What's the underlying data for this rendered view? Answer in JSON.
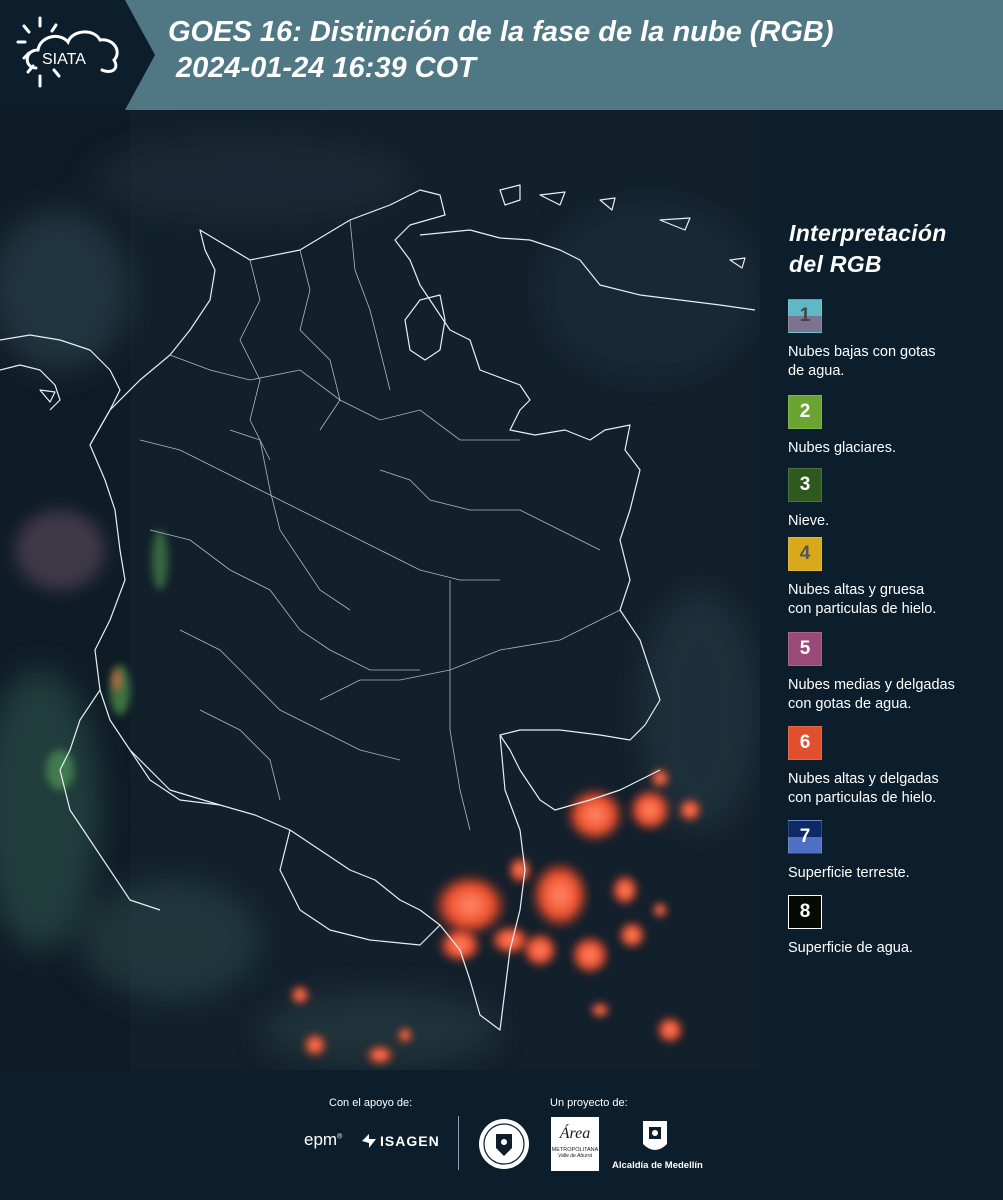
{
  "header": {
    "logo_text": "SIATA",
    "title_line1": "GOES 16: Distinción de la fase de la nube (RGB)",
    "title_line2": "2024-01-24 16:39 COT",
    "band_color": "#4f7784"
  },
  "legend": {
    "title_line1": "Interpretación",
    "title_line2": "del RGB",
    "items": [
      {
        "number": "1",
        "text_line1": "Nubes bajas con gotas",
        "text_line2": "de agua.",
        "color_top": "#5fb8c6",
        "color_bottom": "#7c7390",
        "num_color": "#444444"
      },
      {
        "number": "2",
        "text_line1": "Nubes glaciares.",
        "text_line2": "",
        "color_top": "#6aa532",
        "color_bottom": "#6aa532",
        "num_color": "#ffffff"
      },
      {
        "number": "3",
        "text_line1": "Nieve.",
        "text_line2": "",
        "color_top": "#2e5a1f",
        "color_bottom": "#2e5a1f",
        "num_color": "#ffffff"
      },
      {
        "number": "4",
        "text_line1": "Nubes altas y gruesa",
        "text_line2": "con particulas de hielo.",
        "color_top": "#d9a91c",
        "color_bottom": "#d9a91c",
        "num_color": "#555555"
      },
      {
        "number": "5",
        "text_line1": "Nubes medias y delgadas",
        "text_line2": "con gotas de agua.",
        "color_top": "#9b4a78",
        "color_bottom": "#9b4a78",
        "num_color": "#ffffff"
      },
      {
        "number": "6",
        "text_line1": "Nubes altas y delgadas",
        "text_line2": "con particulas de hielo.",
        "color_top": "#e0502c",
        "color_bottom": "#e0502c",
        "num_color": "#ffffff"
      },
      {
        "number": "7",
        "text_line1": "Superficie terreste.",
        "text_line2": "",
        "color_top": "#0e2a66",
        "color_bottom": "#4e6fc2",
        "num_color": "#ffffff"
      },
      {
        "number": "8",
        "text_line1": "Superficie de agua.",
        "text_line2": "",
        "color_top": "#050a05",
        "color_bottom": "#050a05",
        "num_color": "#ffffff"
      }
    ]
  },
  "footer": {
    "support_label": "Con el apoyo de:",
    "project_label": "Un proyecto de:",
    "sponsor_epm": "epm",
    "sponsor_isagen": "ISAGEN",
    "area_logo_text": "Área",
    "area_sub1": "METROPOLITANA",
    "area_sub2": "Valle de Aburrá",
    "alcaldia_label": "Alcaldía de Medellín"
  }
}
